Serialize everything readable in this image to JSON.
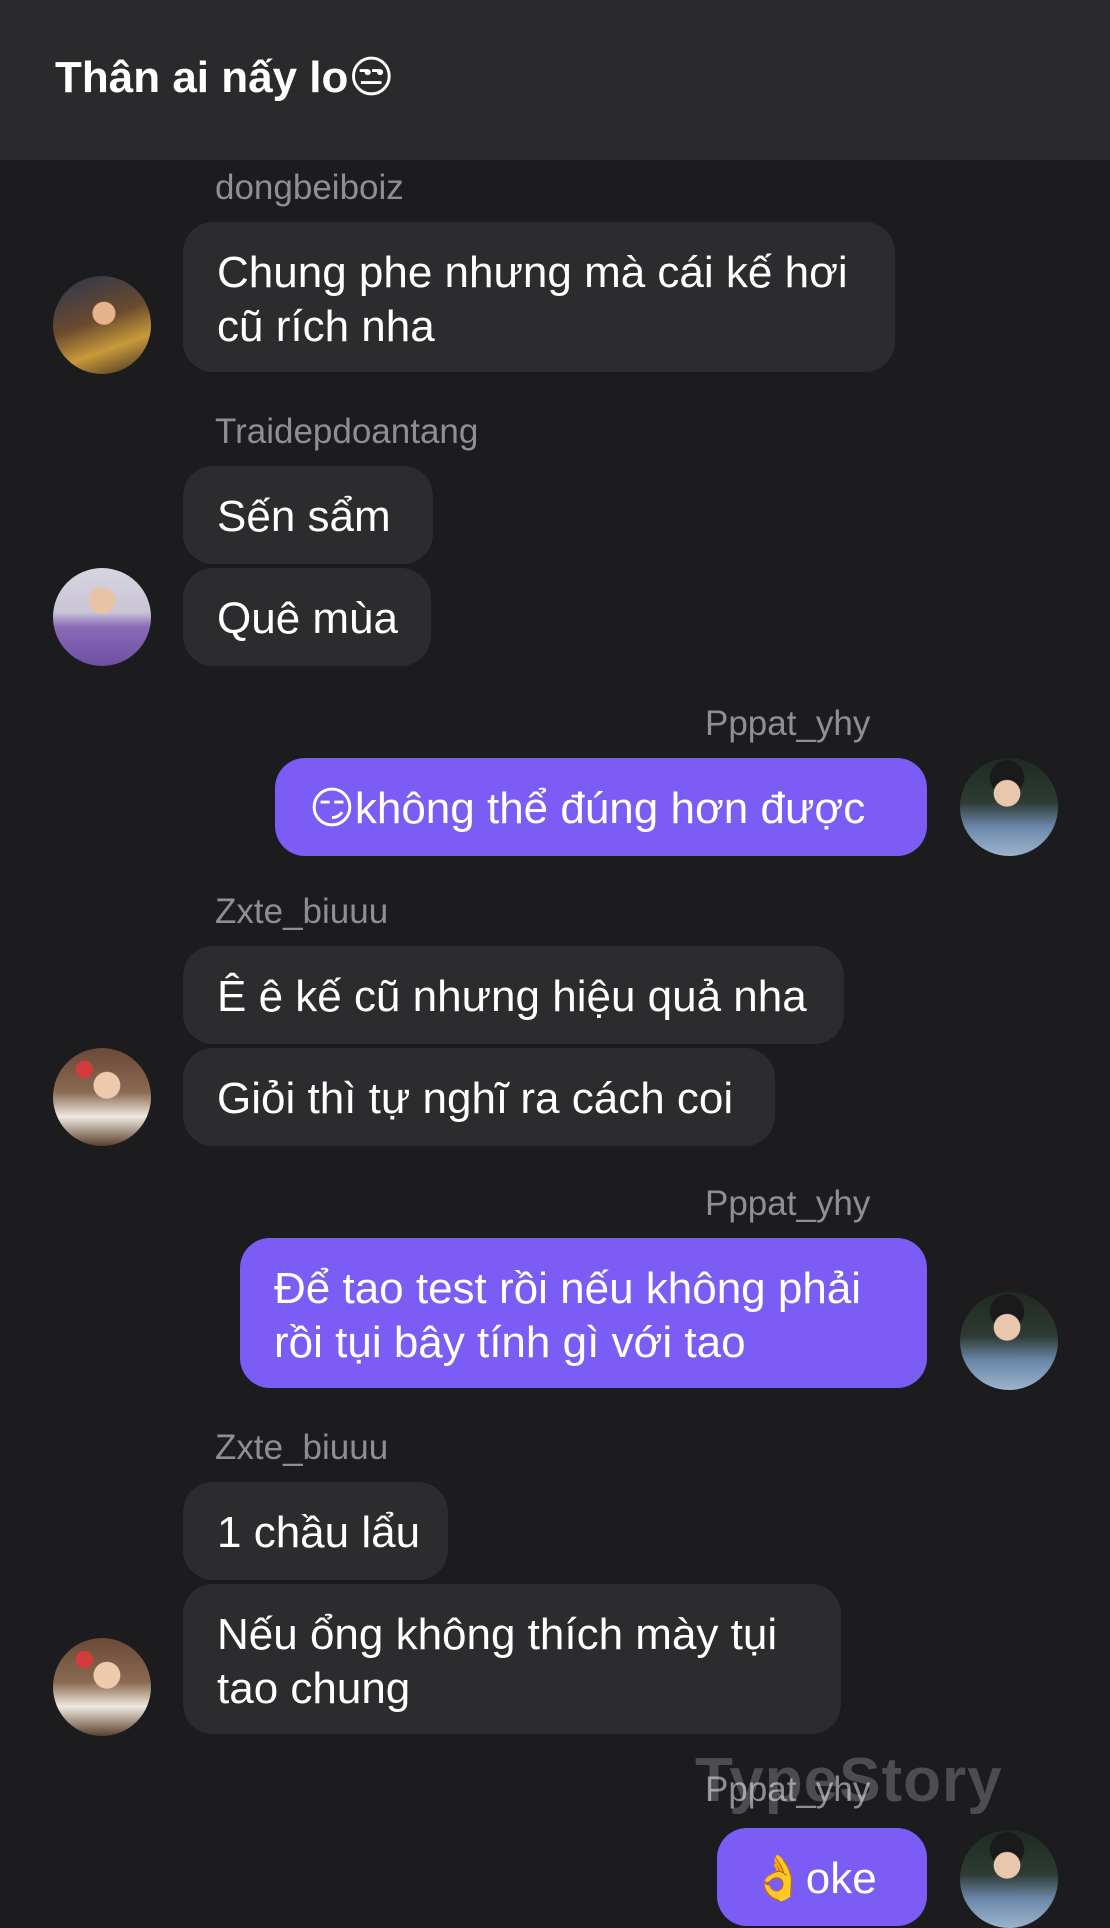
{
  "header": {
    "title": "Thân ai nấy lo😒"
  },
  "messages": [
    {
      "sender": "dongbeiboiz",
      "lines": [
        "Chung phe nhưng mà cái kế hơi",
        "cũ rích nha"
      ]
    },
    {
      "sender": "Traidepdoantang",
      "bubbles": [
        "Sến sẩm",
        "Quê mùa"
      ]
    },
    {
      "sender": "Pppat_yhy",
      "text": "😏không thể đúng hơn được"
    },
    {
      "sender": "Zxte_biuuu",
      "bubbles": [
        "Ê ê kế cũ nhưng hiệu quả nha",
        "Giỏi thì tự nghĩ ra cách coi"
      ]
    },
    {
      "sender": "Pppat_yhy",
      "lines": [
        "Để tao test rồi nếu không phải",
        "rồi tụi bây tính gì với tao"
      ]
    },
    {
      "sender": "Zxte_biuuu",
      "bubbles": [
        "1 chầu lẩu"
      ],
      "lines": [
        "Nếu ổng không thích mày tụi",
        "tao chung"
      ]
    },
    {
      "sender": "Pppat_yhy",
      "text": "👌oke"
    }
  ],
  "watermark": "TypeStory",
  "colors": {
    "background": "#1c1c1e",
    "header": "#2a2a2c",
    "incoming_bubble": "#2c2c2e",
    "outgoing_bubble": "#7b5cf5",
    "sender_name": "#8e8e93"
  }
}
